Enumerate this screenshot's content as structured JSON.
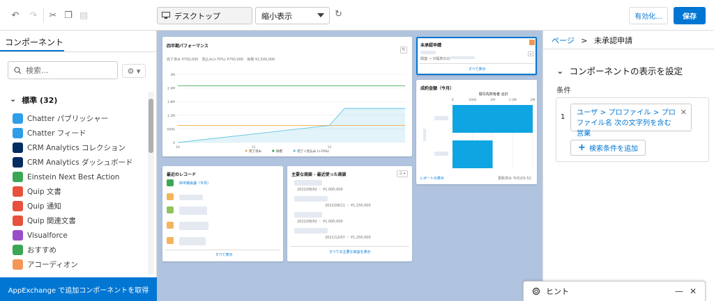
{
  "toolbar": {
    "device_label": "デスクトップ",
    "zoom_label": "縮小表示",
    "activate_label": "有効化...",
    "save_label": "保存"
  },
  "left_panel": {
    "tab_label": "コンポーネント",
    "search_placeholder": "検索...",
    "section_label": "標準 (32)",
    "items": [
      {
        "label": "Chatter パブリッシャー",
        "color": "#2e9ee8",
        "icon": "bolt-icon"
      },
      {
        "label": "Chatter フィード",
        "color": "#2e9ee8",
        "icon": "chat-icon"
      },
      {
        "label": "CRM Analytics コレクション",
        "color": "#032d60",
        "icon": "bar-chart-icon"
      },
      {
        "label": "CRM Analytics ダッシュボード",
        "color": "#032d60",
        "icon": "bar-chart-icon"
      },
      {
        "label": "Einstein Next Best Action",
        "color": "#3ba755",
        "icon": "einstein-icon"
      },
      {
        "label": "Quip 文書",
        "color": "#e8513b",
        "icon": "quip-icon"
      },
      {
        "label": "Quip 通知",
        "color": "#e8513b",
        "icon": "quip-icon"
      },
      {
        "label": "Quip 関連文書",
        "color": "#e8513b",
        "icon": "quip-icon"
      },
      {
        "label": "Visualforce",
        "color": "#9b4dc9",
        "icon": "code-icon"
      },
      {
        "label": "おすすめ",
        "color": "#3ba755",
        "icon": "recommend-icon"
      },
      {
        "label": "アコーディオン",
        "color": "#f49756",
        "icon": "accordion-icon"
      }
    ],
    "footer_label": "AppExchange で追加コンポーネントを取得"
  },
  "canvas": {
    "perf_card": {
      "title": "四半期パフォーマンス",
      "stats": "完了済み ¥750,000　見込み(>70%) ¥750,000　目標 ¥2,500,000",
      "legend": [
        "完了済み",
        "目標",
        "完了＋見込み (>70%)"
      ],
      "colors": {
        "closed": "#f4b45b",
        "goal": "#3ba755",
        "open": "#5ec4e0"
      }
    },
    "approval_card": {
      "title": "未承認申請",
      "row_meta": "関連 → 日程表のの",
      "view_all": "すべて表示"
    },
    "deals_card": {
      "title": "成約金額（今月）",
      "chart_title": "取引先所有者 合計",
      "link_report": "レポートの表示",
      "updated": "更新済み 今日の5:52"
    },
    "recent_card": {
      "title": "最近のレコード",
      "first_item": "四半期会議（今月）",
      "view_all": "すべて表示"
    },
    "deals_list_card": {
      "title": "主要な商談 - 最近使った商談",
      "rows": [
        {
          "meta": "2022/08/02 ・ ¥1,000,000"
        },
        {
          "meta": "2022/08/11 ・ ¥1,150,000"
        },
        {
          "meta": "2022/08/02 ・ ¥1,000,000"
        },
        {
          "meta": "2021/12/07 ・ ¥1,250,000"
        }
      ],
      "view_all": "すべての主要な商談を表示"
    }
  },
  "right_panel": {
    "breadcrumb_parent": "ページ",
    "breadcrumb_current": "未承認申請",
    "section_label": "コンポーネントの表示を設定",
    "condition_label": "条件",
    "condition_number": "1",
    "condition_text": "ユーザ > プロファイル > プロファイル名 次の文字列を含む 営業",
    "add_condition_label": "検索条件を追加"
  },
  "hint": {
    "label": "ヒント"
  },
  "chart_data": [
    {
      "type": "line",
      "title": "",
      "x": [
        10,
        11,
        12
      ],
      "xlim": [
        10,
        13
      ],
      "ylim": [
        0,
        3
      ],
      "y_ticks": [
        "0",
        "600k",
        "1.2M",
        "1.8M",
        "2.4M",
        "3M"
      ],
      "series": [
        {
          "name": "完了済み",
          "points": [
            [
              10,
              0.75
            ],
            [
              13,
              0.75
            ]
          ]
        },
        {
          "name": "目標",
          "points": [
            [
              10,
              2.5
            ],
            [
              13,
              2.5
            ]
          ]
        },
        {
          "name": "完了＋見込み (>70%)",
          "points": [
            [
              10,
              0.0
            ],
            [
              12,
              0.75
            ],
            [
              12.2,
              1.5
            ],
            [
              13,
              1.5
            ]
          ]
        }
      ]
    },
    {
      "type": "bar",
      "orientation": "horizontal",
      "title": "取引先所有者 合計",
      "x_ticks": [
        "0",
        "500k",
        "1M",
        "1.5M",
        "2M"
      ],
      "xlim": [
        0,
        2
      ],
      "values": [
        2.0,
        1.0
      ]
    }
  ]
}
